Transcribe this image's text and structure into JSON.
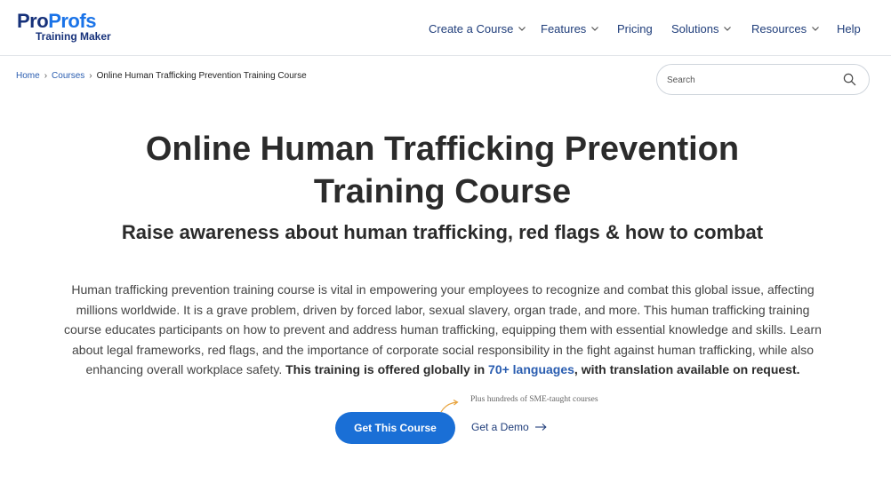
{
  "brand": {
    "logo_pro": "Pro",
    "logo_profs": "Profs",
    "logo_sub": "Training Maker",
    "colors": {
      "navy": "#16317a",
      "blue": "#1a73e8",
      "cta": "#1a6fd6"
    }
  },
  "nav": {
    "items": [
      {
        "label": "Create a Course",
        "has_dropdown": true,
        "icon": "chevron-down-icon"
      },
      {
        "label": "Features",
        "has_dropdown": true,
        "icon": "chevron-down-icon"
      },
      {
        "label": "Pricing",
        "has_dropdown": false
      },
      {
        "label": "Solutions",
        "has_dropdown": true,
        "icon": "chevron-down-icon"
      },
      {
        "label": "Resources",
        "has_dropdown": true,
        "icon": "chevron-down-icon"
      },
      {
        "label": "Help",
        "has_dropdown": false
      }
    ]
  },
  "breadcrumb": {
    "items": [
      "Home",
      "Courses"
    ],
    "separator": "›",
    "current": "Online Human Trafficking Prevention Training Course"
  },
  "search": {
    "placeholder": "Search",
    "value": "",
    "icon": "search-icon"
  },
  "hero": {
    "title_line1": "Online Human Trafficking Prevention",
    "title_line2": "Training Course",
    "subtitle": "Raise awareness about human trafficking, red flags & how to combat",
    "description": "Human trafficking prevention training course is vital in empowering your employees to recognize and combat this global issue, affecting millions worldwide. It is a grave problem, driven by forced labor, sexual slavery, organ trade, and more. This human trafficking training course educates participants on how to prevent and address human trafficking, equipping them with essential knowledge and skills. Learn about legal frameworks, red flags, and the importance of corporate social responsibility in the fight against human trafficking, while also enhancing overall workplace safety.",
    "description_bold_1": "This training is offered globally in",
    "description_link": "70+ languages",
    "description_bold_2": ", with translation available on request."
  },
  "cta": {
    "primary_label": "Get This Course",
    "secondary_label": "Get a Demo",
    "secondary_icon": "arrow-right-icon",
    "note": "Plus hundreds of SME-taught courses",
    "note_icon": "curved-arrow-icon"
  }
}
